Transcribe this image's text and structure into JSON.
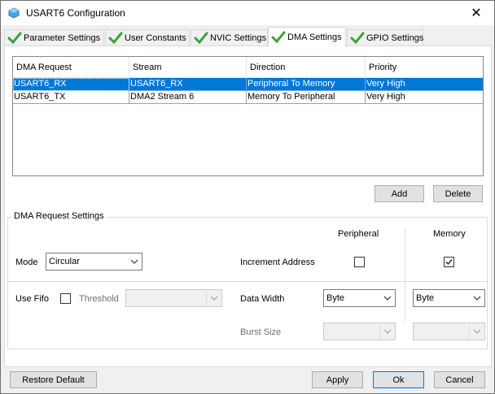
{
  "window": {
    "title": "USART6 Configuration",
    "close_glyph": "✕"
  },
  "tabs": [
    {
      "label": "Parameter Settings"
    },
    {
      "label": "User Constants"
    },
    {
      "label": "NVIC Settings"
    },
    {
      "label": "DMA Settings"
    },
    {
      "label": "GPIO Settings"
    }
  ],
  "table": {
    "columns": [
      "DMA Request",
      "Stream",
      "Direction",
      "Priority"
    ],
    "rows": [
      [
        "USART6_RX",
        "USART6_RX",
        "Peripheral To Memory",
        "Very High"
      ],
      [
        "USART6_TX",
        "DMA2 Stream 6",
        "Memory To Peripheral",
        "Very High"
      ]
    ]
  },
  "buttons": {
    "add": "Add",
    "delete": "Delete"
  },
  "settings": {
    "title": "DMA Request Settings",
    "peripheral_header": "Peripheral",
    "memory_header": "Memory",
    "mode_label": "Mode",
    "mode_value": "Circular",
    "increment_label": "Increment Address",
    "use_fifo_label": "Use Fifo",
    "threshold_label": "Threshold",
    "data_width_label": "Data Width",
    "peripheral_width": "Byte",
    "memory_width": "Byte",
    "burst_size_label": "Burst Size",
    "peripheral_increment": false,
    "memory_increment": true,
    "use_fifo": false
  },
  "footer": {
    "restore": "Restore Default",
    "apply": "Apply",
    "ok": "Ok",
    "cancel": "Cancel"
  },
  "colors": {
    "selection": "#0078d7",
    "check_green": "#3aa43a"
  }
}
